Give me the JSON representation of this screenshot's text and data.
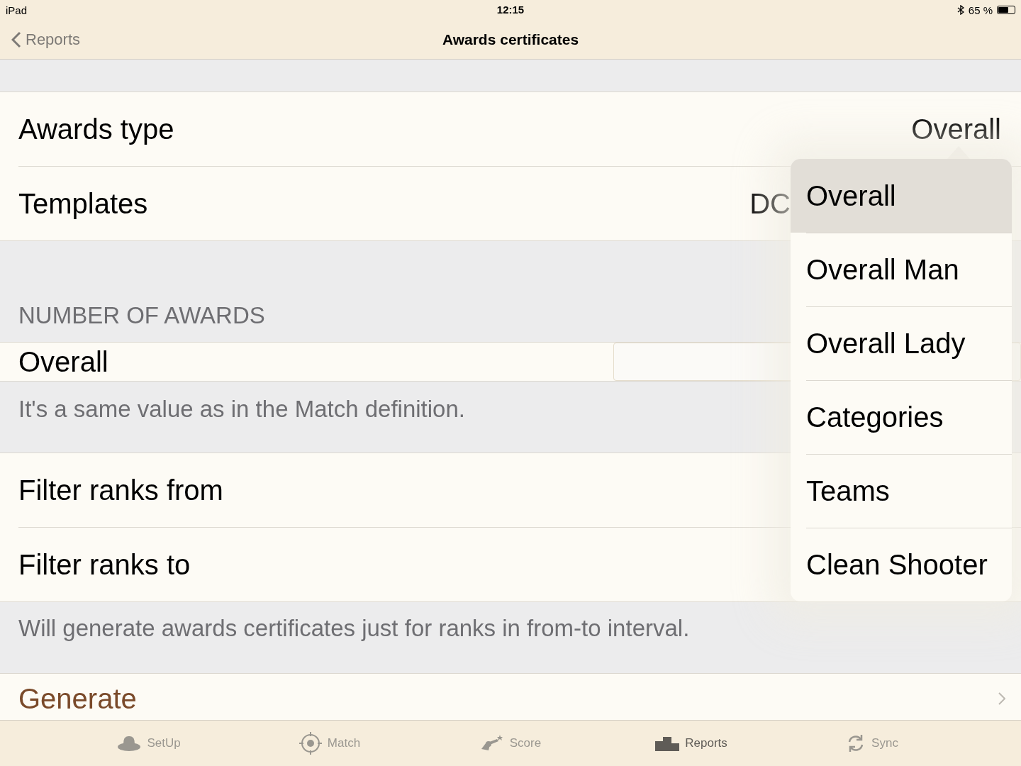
{
  "status_bar": {
    "device": "iPad",
    "time": "12:15",
    "battery_text": "65 %"
  },
  "nav": {
    "back": "Reports",
    "title": "Awards certificates"
  },
  "rows_top": [
    {
      "label": "Awards type",
      "value": "Overall"
    },
    {
      "label": "Templates",
      "value": "DC"
    }
  ],
  "awards_section": {
    "header": "NUMBER OF AWARDS",
    "row_label": "Overall",
    "footer": "It's a same value as in the Match definition."
  },
  "rows_filter": [
    {
      "label": "Filter ranks from"
    },
    {
      "label": "Filter ranks to"
    }
  ],
  "filter_footer": "Will generate awards certificates just for ranks in from-to interval.",
  "generate": {
    "label": "Generate"
  },
  "popover": {
    "items": [
      {
        "label": "Overall",
        "selected": true
      },
      {
        "label": "Overall Man",
        "selected": false
      },
      {
        "label": "Overall Lady",
        "selected": false
      },
      {
        "label": "Categories",
        "selected": false
      },
      {
        "label": "Teams",
        "selected": false
      },
      {
        "label": "Clean Shooter",
        "selected": false
      }
    ]
  },
  "tab_bar": [
    {
      "label": "SetUp",
      "kind": "hat",
      "selected": false
    },
    {
      "label": "Match",
      "kind": "target",
      "selected": false
    },
    {
      "label": "Score",
      "kind": "gun",
      "selected": false
    },
    {
      "label": "Reports",
      "kind": "podium",
      "selected": true
    },
    {
      "label": "Sync",
      "kind": "sync",
      "selected": false
    }
  ]
}
